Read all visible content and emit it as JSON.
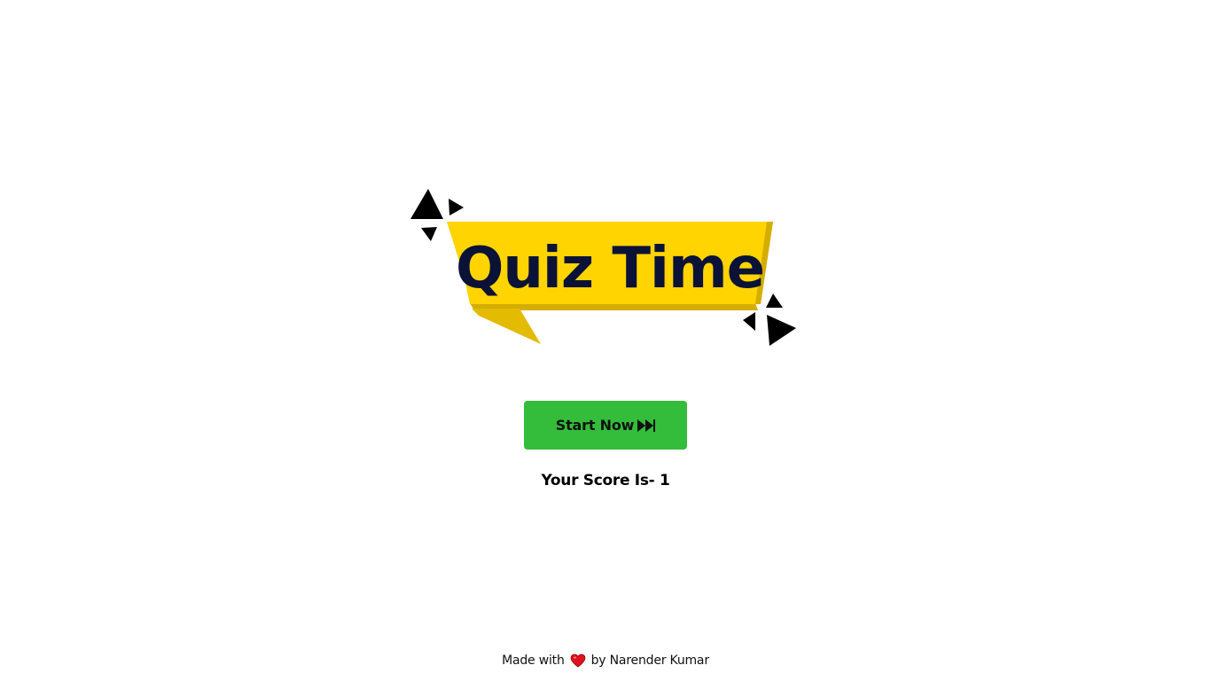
{
  "logo": {
    "title": "Quiz Time",
    "ribbon_color": "#ffd400",
    "ribbon_shadow_color": "#d4ad00",
    "text_color": "#0b1238",
    "confetti_icon": "triangle-confetti-icon"
  },
  "start_button": {
    "label": "Start Now",
    "icon": "fast-forward-icon",
    "background": "#33bd3b"
  },
  "score": {
    "text": "Your Score Is- 1"
  },
  "footer": {
    "prefix": "Made with",
    "icon": "heart-icon",
    "suffix": "by Narender Kumar"
  }
}
